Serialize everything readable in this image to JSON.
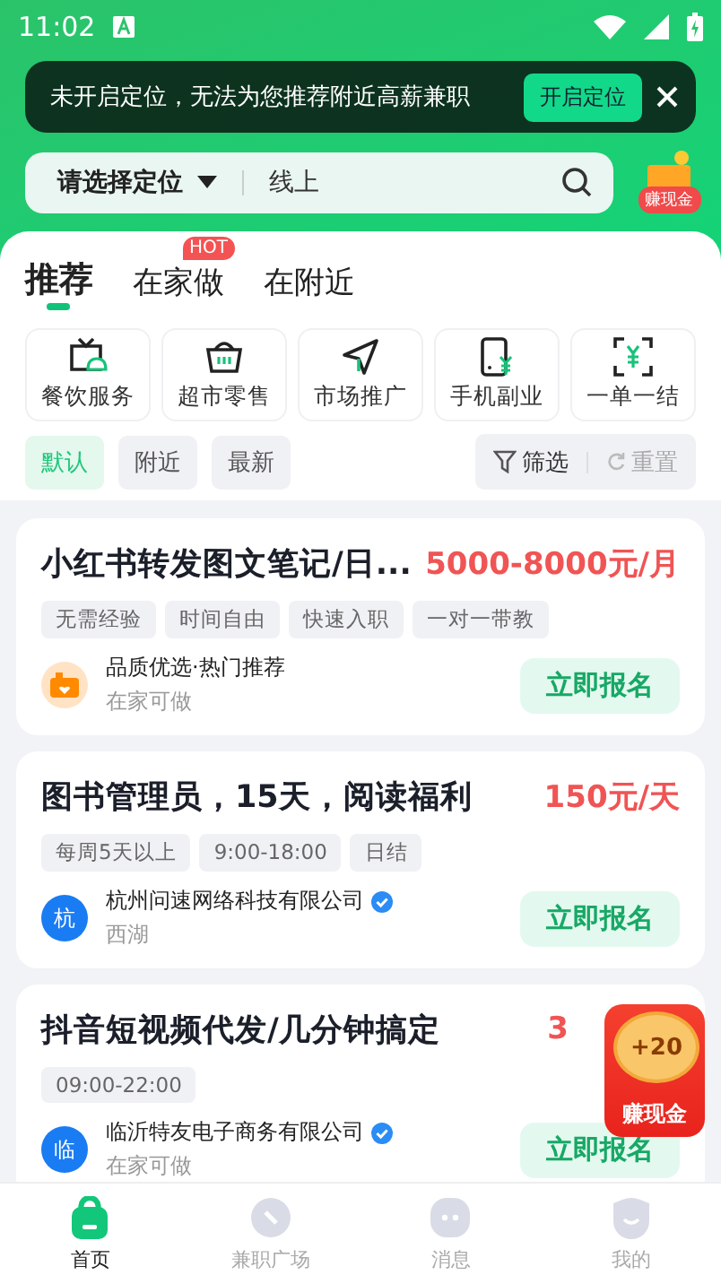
{
  "status_bar": {
    "time": "11:02"
  },
  "location_toast": {
    "message": "未开启定位，无法为您推荐附近高薪兼职",
    "action": "开启定位"
  },
  "search": {
    "location": "请选择定位",
    "value": "线上"
  },
  "reward_entry": {
    "label": "赚现金"
  },
  "tabs": [
    {
      "label": "推荐",
      "selected": true
    },
    {
      "label": "在家做",
      "selected": false,
      "badge": "HOT"
    },
    {
      "label": "在附近",
      "selected": false
    }
  ],
  "categories": [
    {
      "label": "餐饮服务"
    },
    {
      "label": "超市零售"
    },
    {
      "label": "市场推广"
    },
    {
      "label": "手机副业"
    },
    {
      "label": "一单一结"
    }
  ],
  "sort_options": [
    {
      "label": "默认",
      "selected": true
    },
    {
      "label": "附近",
      "selected": false
    },
    {
      "label": "最新",
      "selected": false
    }
  ],
  "filter": {
    "label": "筛选"
  },
  "reset": {
    "label": "重置",
    "disabled": true
  },
  "jobs": [
    {
      "title": "小红书转发图文笔记/日...",
      "salary": "5000-8000元/月",
      "tags": [
        "无需经验",
        "时间自由",
        "快速入职",
        "一对一带教"
      ],
      "avatar": {
        "kind": "icon"
      },
      "company": "品质优选·热门推荐",
      "verified": false,
      "location": "在家可做",
      "action": "立即报名"
    },
    {
      "title": "图书管理员，15天，阅读福利",
      "salary": "150元/天",
      "tags": [
        "每周5天以上",
        "9:00-18:00",
        "日结"
      ],
      "avatar": {
        "kind": "letter",
        "text": "杭"
      },
      "company": "杭州问速网络科技有限公司",
      "verified": true,
      "location": "西湖",
      "action": "立即报名"
    },
    {
      "title": "抖音短视频代发/几分钟搞定",
      "salary": "3",
      "tags": [
        "09:00-22:00"
      ],
      "avatar": {
        "kind": "letter",
        "text": "临"
      },
      "company": "临沂特友电子商务有限公司",
      "verified": true,
      "location": "在家可做",
      "action": "立即报名"
    }
  ],
  "floating_reward": {
    "amount": "+20",
    "label": "赚现金"
  },
  "bottom_nav": [
    {
      "label": "首页",
      "selected": true
    },
    {
      "label": "兼职广场",
      "selected": false
    },
    {
      "label": "消息",
      "selected": false
    },
    {
      "label": "我的",
      "selected": false
    }
  ]
}
